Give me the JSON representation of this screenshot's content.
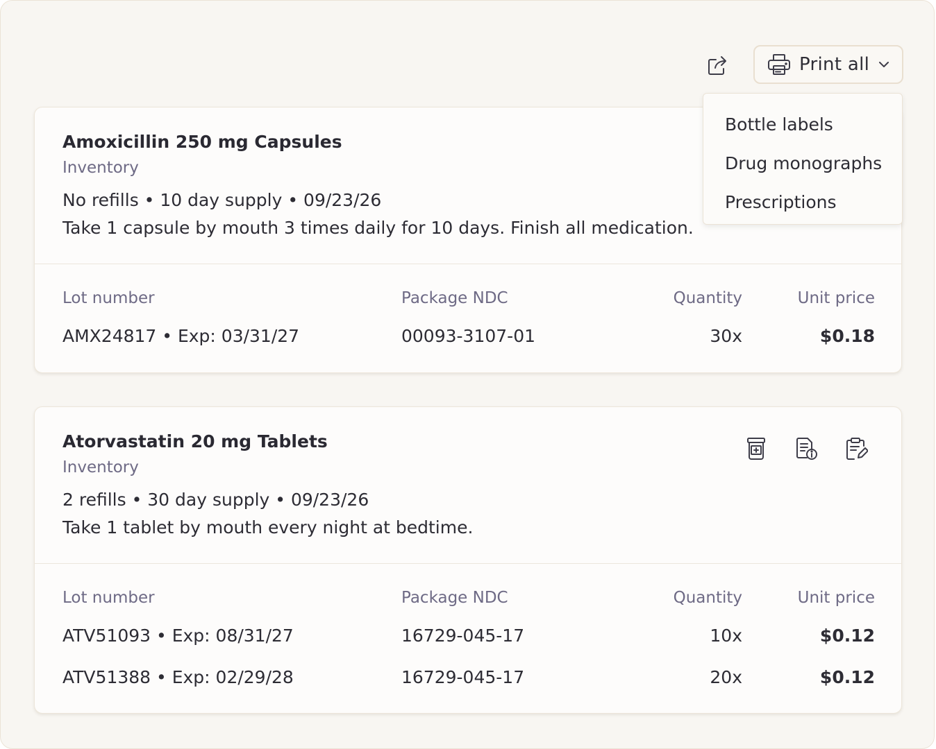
{
  "toolbar": {
    "share_icon": "share-icon",
    "print_label": "Print all",
    "print_icon": "printer-icon",
    "chevron_icon": "chevron-down-icon"
  },
  "print_menu": {
    "options": [
      "Bottle labels",
      "Drug monographs",
      "Prescriptions"
    ]
  },
  "medications": [
    {
      "name": "Amoxicillin 250 mg Capsules",
      "source": "Inventory",
      "meta": "No refills • 10 day supply • 09/23/26",
      "sig": "Take 1 capsule by mouth 3 times daily for 10 days. Finish all medication.",
      "headers": {
        "lot": "Lot number",
        "ndc": "Package NDC",
        "qty": "Quantity",
        "price": "Unit price"
      },
      "rows": [
        {
          "lot": "AMX24817 • Exp: 03/31/27",
          "ndc": "00093-3107-01",
          "qty": "30x",
          "price": "$0.18"
        }
      ]
    },
    {
      "name": "Atorvastatin 20 mg Tablets",
      "source": "Inventory",
      "meta": "2 refills • 30 day supply • 09/23/26",
      "sig": "Take 1 tablet by mouth every night at bedtime.",
      "actions": [
        "bottle-label-icon",
        "drug-monograph-icon",
        "prescription-edit-icon"
      ],
      "headers": {
        "lot": "Lot number",
        "ndc": "Package NDC",
        "qty": "Quantity",
        "price": "Unit price"
      },
      "rows": [
        {
          "lot": "ATV51093 • Exp: 08/31/27",
          "ndc": "16729-045-17",
          "qty": "10x",
          "price": "$0.12"
        },
        {
          "lot": "ATV51388 • Exp: 02/29/28",
          "ndc": "16729-045-17",
          "qty": "20x",
          "price": "$0.12"
        }
      ]
    }
  ]
}
